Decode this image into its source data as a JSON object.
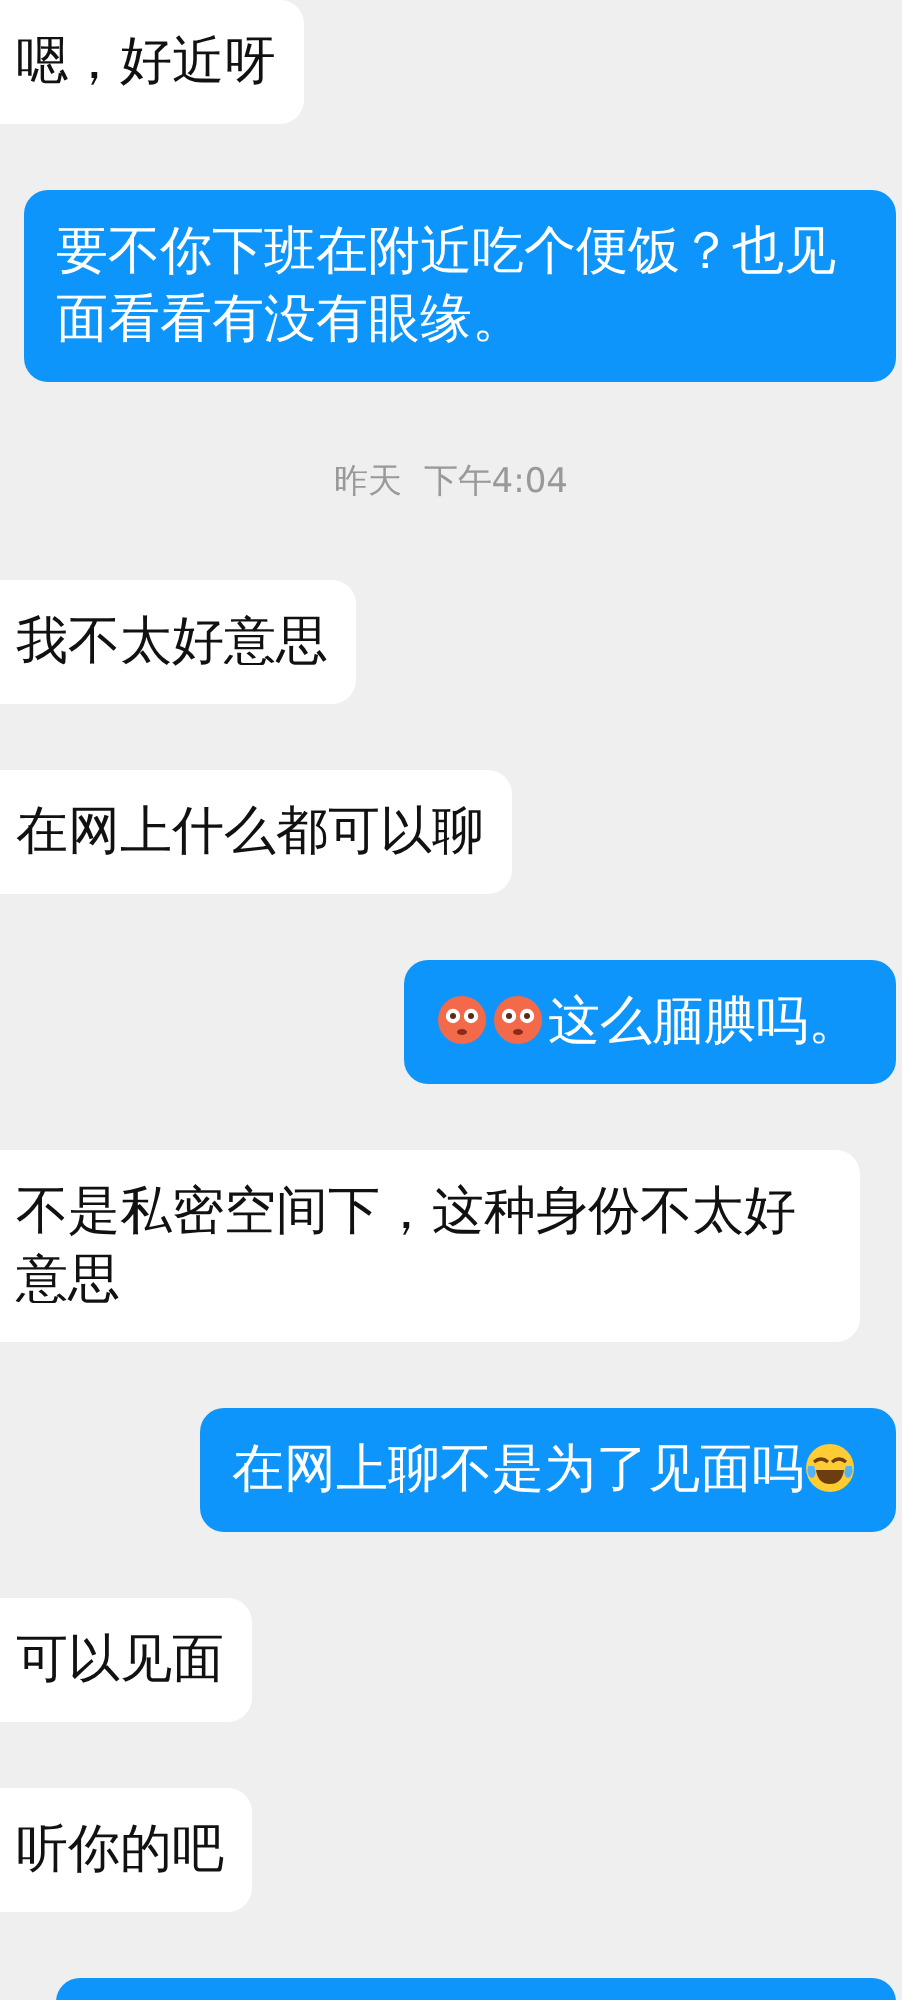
{
  "messages": [
    {
      "kind": "incoming",
      "parts": [
        {
          "kind": "text",
          "text": "嗯，好近呀"
        }
      ]
    },
    {
      "kind": "outgoing",
      "parts": [
        {
          "kind": "text",
          "text": "要不你下班在附近吃个便饭？也见面看看有没有眼缘。"
        }
      ]
    },
    {
      "kind": "time",
      "text": "昨天  下午4:04"
    },
    {
      "kind": "incoming",
      "parts": [
        {
          "kind": "text",
          "text": "我不太好意思"
        }
      ]
    },
    {
      "kind": "incoming",
      "parts": [
        {
          "kind": "text",
          "text": "在网上什么都可以聊"
        }
      ]
    },
    {
      "kind": "outgoing",
      "parts": [
        {
          "kind": "flushed"
        },
        {
          "kind": "flushed"
        },
        {
          "kind": "text",
          "text": "这么腼腆吗。"
        }
      ]
    },
    {
      "kind": "incoming",
      "parts": [
        {
          "kind": "text",
          "text": "不是私密空间下，这种身份不太好意思"
        }
      ]
    },
    {
      "kind": "outgoing",
      "parts": [
        {
          "kind": "text",
          "text": "在网上聊不是为了见面吗"
        },
        {
          "kind": "tears-of-joy"
        }
      ]
    },
    {
      "kind": "incoming",
      "parts": [
        {
          "kind": "text",
          "text": "可以见面"
        }
      ]
    },
    {
      "kind": "incoming",
      "parts": [
        {
          "kind": "text",
          "text": "听你的吧"
        }
      ]
    },
    {
      "kind": "outgoing-cut"
    }
  ]
}
